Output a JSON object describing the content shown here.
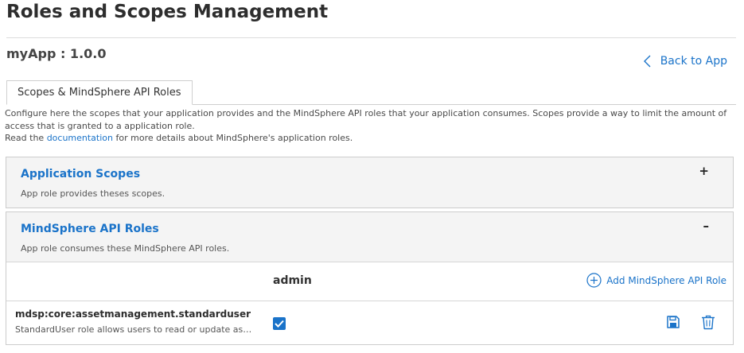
{
  "page": {
    "title": "Roles and Scopes Management",
    "app_name": "myApp : 1.0.0",
    "back_label": "Back to App"
  },
  "tabs": [
    {
      "label": "Scopes & MindSphere API Roles",
      "active": true
    }
  ],
  "description": {
    "line1": "Configure here the scopes that your application provides and the MindSphere API roles that your application consumes. Scopes provide a way to limit the amount of access that is granted to a application role.",
    "line2_prefix": "Read the ",
    "link_text": "documentation",
    "line2_suffix": " for more details about MindSphere's application roles."
  },
  "application_scopes": {
    "title": "Application Scopes",
    "subtitle": "App role provides theses scopes.",
    "toggle": "+"
  },
  "api_roles": {
    "title": "MindSphere API Roles",
    "subtitle": "App role consumes these MindSphere API roles.",
    "toggle": "–",
    "column_header": "admin",
    "add_label": "Add MindSphere API Role",
    "rows": [
      {
        "name": "mdsp:core:assetmanagement.standarduser",
        "description": "StandardUser role allows users to read or update asset...",
        "admin_checked": true
      }
    ]
  },
  "colors": {
    "accent": "#1a73c9",
    "header_bg": "#f4f4f4",
    "border": "#cccccc"
  },
  "icons": {
    "back": "chevron-left-icon",
    "add": "plus-circle-icon",
    "save": "floppy-disk-icon",
    "delete": "trash-icon",
    "check": "checkmark-icon"
  }
}
